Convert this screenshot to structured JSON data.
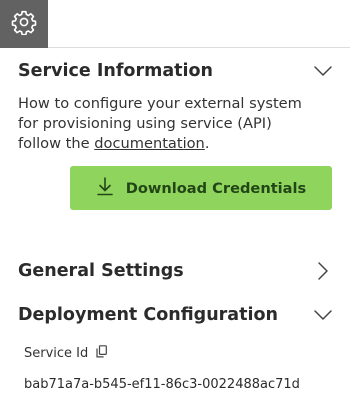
{
  "toolbar": {
    "settings_icon": "gear-icon"
  },
  "service_information": {
    "title": "Service Information",
    "expanded": true,
    "chevron_icon": "chevron-down-icon",
    "description_prefix": "How to configure your external system for provisioning using service (API) follow the ",
    "documentation_link": "documentation",
    "description_suffix": ".",
    "download_button": {
      "label": "Download Credentials",
      "icon": "download-icon",
      "color": "#8fd45c"
    }
  },
  "general_settings": {
    "title": "General Settings",
    "expanded": false,
    "chevron_icon": "chevron-right-icon"
  },
  "deployment_configuration": {
    "title": "Deployment Configuration",
    "expanded": true,
    "chevron_icon": "chevron-down-icon",
    "service_id_label": "Service Id",
    "copy_icon": "copy-icon",
    "service_id_value": "bab71a7a-b545-ef11-86c3-0022488ac71d"
  }
}
